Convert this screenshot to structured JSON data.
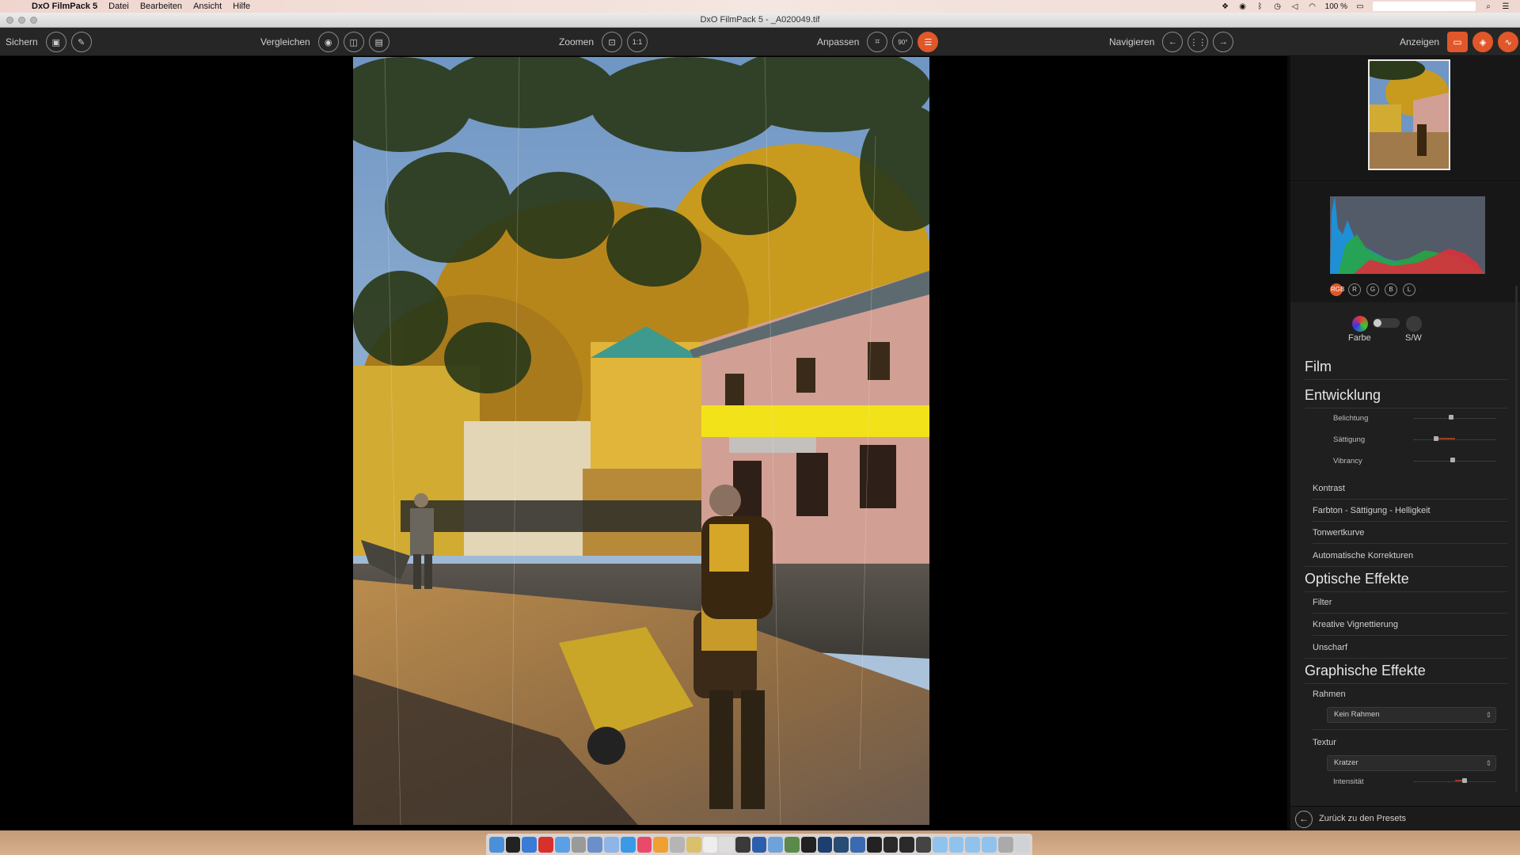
{
  "menubar": {
    "app_name": "DxO FilmPack 5",
    "items": [
      "Datei",
      "Bearbeiten",
      "Ansicht",
      "Hilfe"
    ],
    "battery": "100 %"
  },
  "window": {
    "title": "DxO FilmPack 5 - _A020049.tif"
  },
  "toolbar": {
    "save": {
      "label": "Sichern"
    },
    "compare": {
      "label": "Vergleichen"
    },
    "zoom": {
      "label": "Zoomen",
      "one_to_one": "1:1"
    },
    "adjust": {
      "label": "Anpassen",
      "rotate_label": "90°"
    },
    "navigate": {
      "label": "Navigieren"
    },
    "view": {
      "label": "Anzeigen"
    }
  },
  "histogram": {
    "channels": [
      "RGB",
      "R",
      "G",
      "B",
      "L"
    ],
    "active": "RGB"
  },
  "mode": {
    "color_label": "Farbe",
    "bw_label": "S/W"
  },
  "settings": {
    "film": "Film",
    "development": {
      "title": "Entwicklung",
      "sliders": [
        {
          "label": "Belichtung",
          "value": 0.45
        },
        {
          "label": "Sättigung",
          "value": 0.27
        },
        {
          "label": "Vibrancy",
          "value": 0.47
        }
      ],
      "items": [
        "Kontrast",
        "Farbton - Sättigung - Helligkeit",
        "Tonwertkurve",
        "Automatische Korrekturen"
      ]
    },
    "optical": {
      "title": "Optische Effekte",
      "items": [
        "Filter",
        "Kreative Vignettierung",
        "Unscharf"
      ]
    },
    "graphic": {
      "title": "Graphische Effekte",
      "frame_label": "Rahmen",
      "frame_value": "Kein Rahmen",
      "texture_label": "Textur",
      "texture_value": "Kratzer",
      "intensity_label": "Intensität",
      "intensity_value": 0.62
    }
  },
  "bottom": {
    "back_label": "Zurück zu den Presets"
  },
  "colors": {
    "accent": "#e0572a",
    "panel_bg": "#1f1f1f",
    "toolbar_bg": "#262626"
  }
}
